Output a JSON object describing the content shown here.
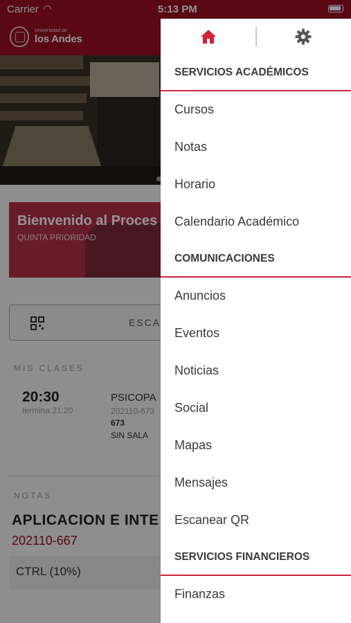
{
  "status_bar": {
    "carrier": "Carrier",
    "time": "5:13 PM"
  },
  "header": {
    "logo_small": "Universidad de",
    "logo_big": "los Andes"
  },
  "home": {
    "banner_title": "Bienvenido al Proces",
    "banner_subtitle": "QUINTA PRIORIDAD",
    "scan_button": "ESCA",
    "classes_label": "MIS CLASES",
    "class": {
      "time": "20:30",
      "ends": "termina 21:20",
      "name": "PSICOPA",
      "code": "202110-673",
      "section": "673",
      "room": "SIN SALA"
    },
    "notes_label": "NOTAS",
    "note": {
      "course": "APLICACION E INTE",
      "code": "202110-667",
      "item": "CTRL (10%)"
    }
  },
  "drawer": {
    "sections": [
      {
        "title": "SERVICIOS ACADÉMICOS",
        "items": [
          "Cursos",
          "Notas",
          "Horario",
          "Calendario Académico"
        ]
      },
      {
        "title": "COMUNICACIONES",
        "items": [
          "Anuncios",
          "Eventos",
          "Noticias",
          "Social",
          "Mapas",
          "Mensajes",
          "Escanear QR"
        ]
      },
      {
        "title": "SERVICIOS FINANCIEROS",
        "items": [
          "Finanzas"
        ]
      }
    ]
  },
  "colors": {
    "brand": "#9a0f24",
    "accent": "#d0243a",
    "text": "#3a3a3a"
  },
  "icons": {
    "home": "home-icon",
    "settings": "gear-icon",
    "qr": "qr-code-icon",
    "wifi": "wifi-icon"
  }
}
